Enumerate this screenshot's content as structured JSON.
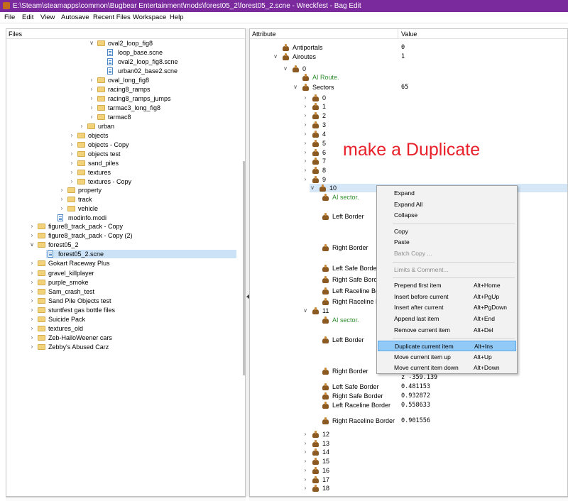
{
  "window": {
    "title": "E:\\Steam\\steamapps\\common\\Bugbear Entertainment\\mods\\forest05_2\\forest05_2.scne - Wreckfest - Bag Edit"
  },
  "menu": [
    "File",
    "Edit",
    "View",
    "Autosave",
    "Recent Files",
    "Workspace",
    "Help"
  ],
  "files_panel": {
    "header": "Files",
    "tree": [
      {
        "label": "oval2_loop_fig8",
        "type": "folder",
        "chev": "down"
      },
      {
        "label": "loop_base.scne",
        "type": "file",
        "chev": ""
      },
      {
        "label": "oval2_loop_fig8.scne",
        "type": "file",
        "chev": ""
      },
      {
        "label": "urban02_base2.scne",
        "type": "file",
        "chev": ""
      },
      {
        "label": "oval_long_fig8",
        "type": "folder",
        "chev": "right"
      },
      {
        "label": "racing8_ramps",
        "type": "folder",
        "chev": "right"
      },
      {
        "label": "racing8_ramps_jumps",
        "type": "folder",
        "chev": "right"
      },
      {
        "label": "tarmac3_long_fig8",
        "type": "folder",
        "chev": "right"
      },
      {
        "label": "tarmac8",
        "type": "folder",
        "chev": "right"
      },
      {
        "label": "urban",
        "type": "folder",
        "chev": "right"
      },
      {
        "label": "objects",
        "type": "folder",
        "chev": "right"
      },
      {
        "label": "objects - Copy",
        "type": "folder",
        "chev": "right"
      },
      {
        "label": "objects test",
        "type": "folder",
        "chev": "right"
      },
      {
        "label": "sand_piles",
        "type": "folder",
        "chev": "right"
      },
      {
        "label": "textures",
        "type": "folder",
        "chev": "right"
      },
      {
        "label": "textures - Copy",
        "type": "folder",
        "chev": "right"
      },
      {
        "label": "property",
        "type": "folder",
        "chev": "right"
      },
      {
        "label": "track",
        "type": "folder",
        "chev": "right"
      },
      {
        "label": "vehicle",
        "type": "folder",
        "chev": "right"
      },
      {
        "label": "modinfo.modi",
        "type": "file",
        "chev": ""
      },
      {
        "label": "figure8_track_pack - Copy",
        "type": "folder",
        "chev": "right"
      },
      {
        "label": "figure8_track_pack - Copy (2)",
        "type": "folder",
        "chev": "right"
      },
      {
        "label": "forest05_2",
        "type": "folder",
        "chev": "down"
      },
      {
        "label": "forest05_2.scne",
        "type": "file",
        "chev": "",
        "selected": true
      },
      {
        "label": "Gokart Raceway Plus",
        "type": "folder",
        "chev": "right"
      },
      {
        "label": "gravel_killplayer",
        "type": "folder",
        "chev": "right"
      },
      {
        "label": "purple_smoke",
        "type": "folder",
        "chev": "right"
      },
      {
        "label": "Sam_crash_test",
        "type": "folder",
        "chev": "right"
      },
      {
        "label": "Sand Pile Objects test",
        "type": "folder",
        "chev": "right"
      },
      {
        "label": "stuntfest gas bottle files",
        "type": "folder",
        "chev": "right"
      },
      {
        "label": "Suicide Pack",
        "type": "folder",
        "chev": "right"
      },
      {
        "label": "textures_old",
        "type": "folder",
        "chev": "right"
      },
      {
        "label": "Zeb-HalloWeener cars",
        "type": "folder",
        "chev": "right"
      },
      {
        "label": "Zebby's Abused Carz",
        "type": "folder",
        "chev": "right"
      }
    ]
  },
  "attribute_panel": {
    "col_attribute": "Attribute",
    "col_value": "Value",
    "rows": [
      {
        "label": "Antiportals",
        "value": "0",
        "chev": "",
        "icon": true,
        "green": false
      },
      {
        "label": "Airoutes",
        "value": "1",
        "chev": "down",
        "icon": true,
        "green": false
      },
      {
        "label": "0",
        "value": "",
        "chev": "down",
        "icon": true,
        "green": false
      },
      {
        "label": "AI Route.",
        "value": "",
        "chev": "",
        "icon": true,
        "green": true
      },
      {
        "label": "Sectors",
        "value": "65",
        "chev": "down",
        "icon": true,
        "green": false
      },
      {
        "label": "0",
        "value": "",
        "chev": "right",
        "icon": true,
        "green": false
      },
      {
        "label": "1",
        "value": "",
        "chev": "right",
        "icon": true,
        "green": false
      },
      {
        "label": "2",
        "value": "",
        "chev": "right",
        "icon": true,
        "green": false
      },
      {
        "label": "3",
        "value": "",
        "chev": "right",
        "icon": true,
        "green": false
      },
      {
        "label": "4",
        "value": "",
        "chev": "right",
        "icon": true,
        "green": false
      },
      {
        "label": "5",
        "value": "",
        "chev": "right",
        "icon": true,
        "green": false
      },
      {
        "label": "6",
        "value": "",
        "chev": "right",
        "icon": true,
        "green": false
      },
      {
        "label": "7",
        "value": "",
        "chev": "right",
        "icon": true,
        "green": false
      },
      {
        "label": "8",
        "value": "",
        "chev": "right",
        "icon": true,
        "green": false
      },
      {
        "label": "9",
        "value": "",
        "chev": "right",
        "icon": true,
        "green": false
      },
      {
        "label": "10",
        "value": "",
        "chev": "down",
        "icon": true,
        "green": false,
        "selected": true
      },
      {
        "label": "AI sector.",
        "value": "",
        "chev": "",
        "icon": true,
        "green": true
      },
      {
        "label": "Left Border",
        "value": "",
        "chev": "",
        "icon": true,
        "green": false
      },
      {
        "label": "Right Border",
        "value": "",
        "chev": "",
        "icon": true,
        "green": false
      },
      {
        "label": "Left Safe Border",
        "value": "",
        "chev": "",
        "icon": true,
        "green": false
      },
      {
        "label": "Right Safe Border",
        "value": "",
        "chev": "",
        "icon": true,
        "green": false
      },
      {
        "label": "Left Raceline Border",
        "value": "",
        "chev": "",
        "icon": true,
        "green": false
      },
      {
        "label": "Right Raceline Border",
        "value": "",
        "chev": "",
        "icon": true,
        "green": false
      },
      {
        "label": "11",
        "value": "",
        "chev": "down",
        "icon": true,
        "green": false
      },
      {
        "label": "AI sector.",
        "value": "",
        "chev": "",
        "icon": true,
        "green": true
      },
      {
        "label": "Left Border",
        "value": "",
        "chev": "",
        "icon": true,
        "green": false
      },
      {
        "label": "Right Border",
        "value": "",
        "chev": "",
        "icon": true,
        "green": false
      },
      {
        "label": "",
        "value": "z -359.139",
        "chev": "",
        "icon": false,
        "green": false
      },
      {
        "label": "Left Safe Border",
        "value": "0.481153",
        "chev": "",
        "icon": true,
        "green": false
      },
      {
        "label": "Right Safe Border",
        "value": "0.932872",
        "chev": "",
        "icon": true,
        "green": false
      },
      {
        "label": "Left Raceline Border",
        "value": "0.558633",
        "chev": "",
        "icon": true,
        "green": false
      },
      {
        "label": "Right Raceline Border",
        "value": "0.901556",
        "chev": "",
        "icon": true,
        "green": false
      },
      {
        "label": "12",
        "value": "",
        "chev": "right",
        "icon": true,
        "green": false
      },
      {
        "label": "13",
        "value": "",
        "chev": "right",
        "icon": true,
        "green": false
      },
      {
        "label": "14",
        "value": "",
        "chev": "right",
        "icon": true,
        "green": false
      },
      {
        "label": "15",
        "value": "",
        "chev": "right",
        "icon": true,
        "green": false
      },
      {
        "label": "16",
        "value": "",
        "chev": "right",
        "icon": true,
        "green": false
      },
      {
        "label": "17",
        "value": "",
        "chev": "right",
        "icon": true,
        "green": false
      },
      {
        "label": "18",
        "value": "",
        "chev": "right",
        "icon": true,
        "green": false
      }
    ]
  },
  "annotation": "make a Duplicate",
  "context_menu": [
    {
      "label": "Expand",
      "shortcut": ""
    },
    {
      "label": "Expand All",
      "shortcut": ""
    },
    {
      "label": "Collapse",
      "shortcut": ""
    },
    {
      "sep": true
    },
    {
      "label": "Copy",
      "shortcut": ""
    },
    {
      "label": "Paste",
      "shortcut": ""
    },
    {
      "label": "Batch Copy ...",
      "shortcut": "",
      "disabled": true
    },
    {
      "sep": true
    },
    {
      "label": "Limits & Comment...",
      "shortcut": "",
      "disabled": true
    },
    {
      "sep": true
    },
    {
      "label": "Prepend first item",
      "shortcut": "Alt+Home"
    },
    {
      "label": "Insert before current",
      "shortcut": "Alt+PgUp"
    },
    {
      "label": "Insert after current",
      "shortcut": "Alt+PgDown"
    },
    {
      "label": "Append last item",
      "shortcut": "Alt+End"
    },
    {
      "label": "Remove current item",
      "shortcut": "Alt+Del"
    },
    {
      "sep": true
    },
    {
      "label": "Duplicate current item",
      "shortcut": "Alt+Ins",
      "highlighted": true
    },
    {
      "label": "Move current item up",
      "shortcut": "Alt+Up"
    },
    {
      "label": "Move current item down",
      "shortcut": "Alt+Down"
    }
  ],
  "colors": {
    "titlebar": "#7b2a9e",
    "annotation": "#e8202a",
    "menu_highlight": "#91c9f7",
    "green_text": "#2e8b2e"
  }
}
